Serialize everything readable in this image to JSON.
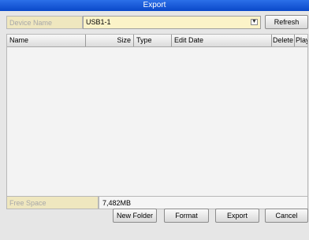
{
  "window": {
    "title": "Export"
  },
  "device": {
    "label": "Device Name",
    "selected": "USB1-1",
    "refresh": "Refresh"
  },
  "table": {
    "columns": [
      "Name",
      "Size",
      "Type",
      "Edit Date",
      "Delete",
      "Play"
    ],
    "rows": []
  },
  "free_space": {
    "label": "Free Space",
    "value": "7,482MB"
  },
  "actions": {
    "new_folder": "New Folder",
    "format": "Format",
    "export": "Export",
    "cancel": "Cancel"
  }
}
